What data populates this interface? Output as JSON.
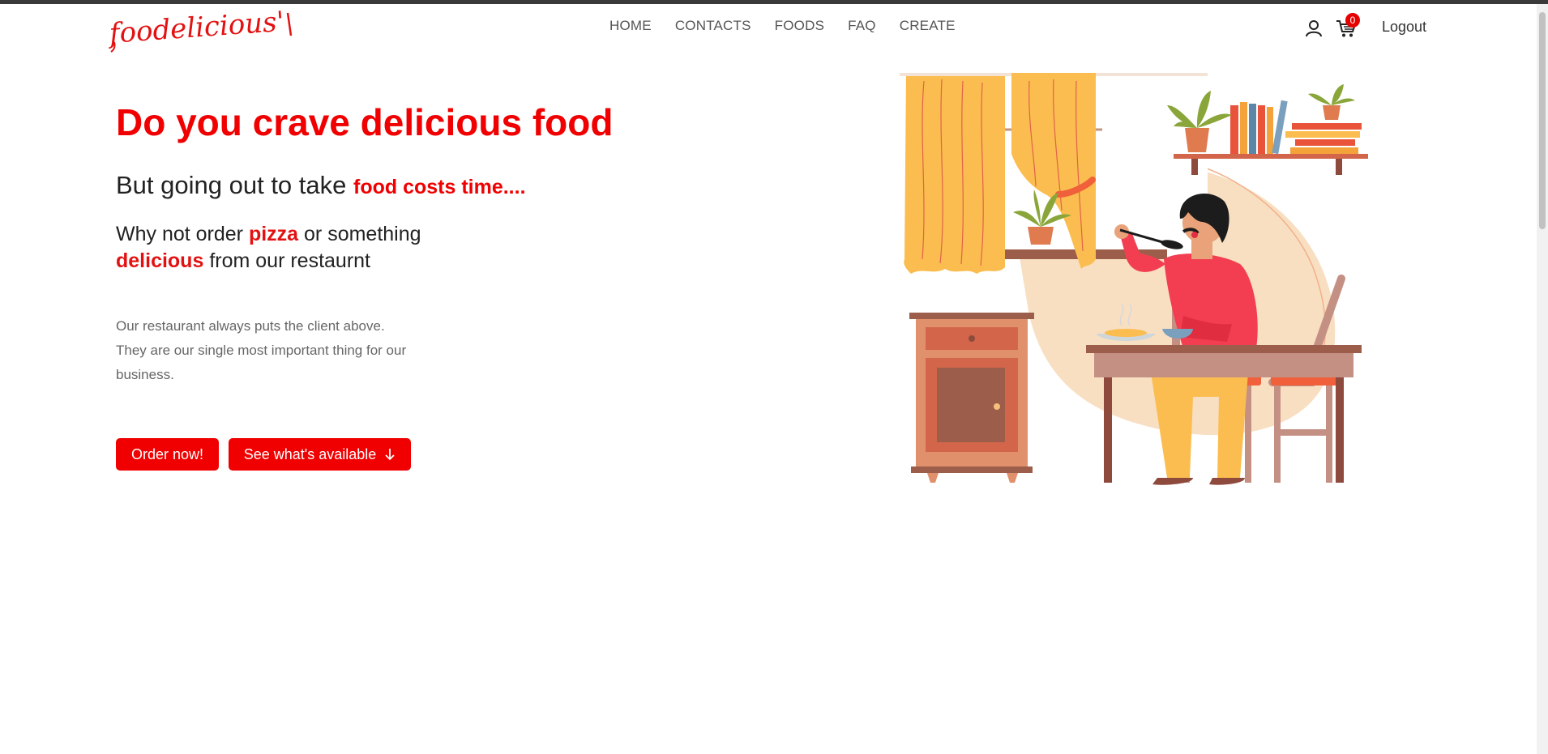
{
  "header": {
    "logo_text": "foodelicious'",
    "nav": [
      "HOME",
      "CONTACTS",
      "FOODS",
      "FAQ",
      "CREATE"
    ],
    "cart_count": "0",
    "logout_label": "Logout"
  },
  "hero": {
    "title": "Do you crave delicious food",
    "sub_prefix": "But going out to take ",
    "sub_highlight": "food costs time....",
    "why_1": "Why not order ",
    "why_pizza": "pizza",
    "why_2": " or something",
    "why_delicious": "delicious",
    "why_3": " from our restaurnt",
    "desc": "Our restaurant always puts the client above. They are our single most important thing for our business.",
    "order_button": "Order now!",
    "available_button": "See what's available"
  },
  "colors": {
    "accent": "#f00000",
    "text": "#222222",
    "muted": "#666666"
  },
  "icons": [
    "user-icon",
    "cart-icon",
    "arrow-down-icon"
  ]
}
